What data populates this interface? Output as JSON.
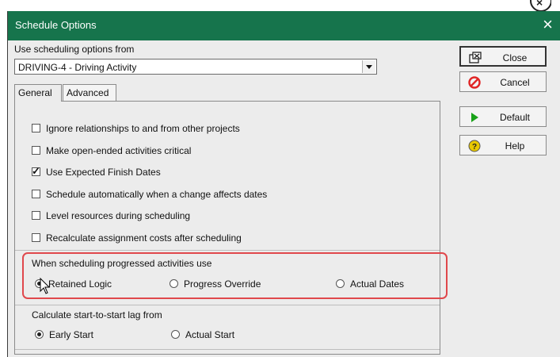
{
  "window": {
    "title": "Schedule Options",
    "close_glyph": "×"
  },
  "source": {
    "label": "Use scheduling options from",
    "selected": "DRIVING-4 - Driving Activity"
  },
  "tabs": [
    {
      "label": "General",
      "active": true
    },
    {
      "label": "Advanced",
      "active": false
    }
  ],
  "options": [
    {
      "label": "Ignore relationships to and from other projects",
      "checked": false
    },
    {
      "label": "Make open-ended activities critical",
      "checked": false
    },
    {
      "label": "Use Expected Finish Dates",
      "checked": true
    },
    {
      "label": "Schedule automatically when a change affects dates",
      "checked": false
    },
    {
      "label": "Level resources during scheduling",
      "checked": false
    },
    {
      "label": "Recalculate assignment costs after scheduling",
      "checked": false
    }
  ],
  "progressed": {
    "label": "When scheduling progressed activities use",
    "choices": [
      "Retained Logic",
      "Progress Override",
      "Actual Dates"
    ],
    "selected": "Retained Logic"
  },
  "lag": {
    "label": "Calculate start-to-start lag from",
    "choices": [
      "Early Start",
      "Actual Start"
    ],
    "selected": "Early Start"
  },
  "buttons": {
    "close": {
      "label": "Close",
      "icon": "close-window-icon"
    },
    "cancel": {
      "label": "Cancel",
      "icon": "cancel-icon"
    },
    "default": {
      "label": "Default",
      "icon": "play-arrow-icon"
    },
    "help": {
      "label": "Help",
      "icon": "help-icon"
    }
  },
  "colors": {
    "titlebar": "#16744c",
    "highlight": "#e0484c",
    "cancel": "#e02525",
    "default": "#19a219",
    "help": "#e8c800"
  }
}
